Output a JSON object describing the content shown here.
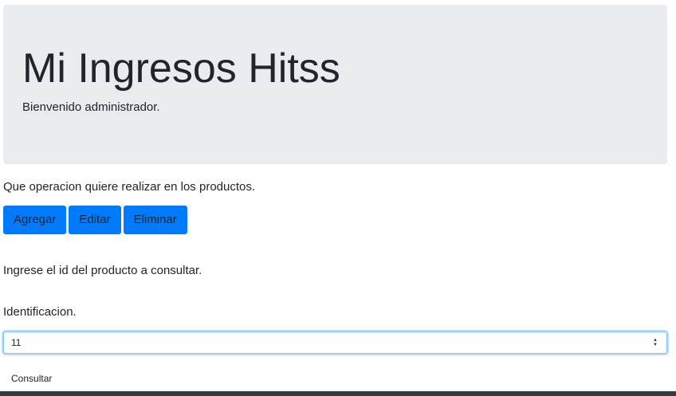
{
  "header": {
    "title": "Mi Ingresos Hitss",
    "welcome": "Bienvenido administrador."
  },
  "main": {
    "operation_prompt": "Que operacion quiere realizar en los productos.",
    "buttons": {
      "add": "Agregar",
      "edit": "Editar",
      "delete": "Eliminar"
    },
    "query_prompt": "Ingrese el id del producto a consultar.",
    "id_label": "Identificacion.",
    "id_input": {
      "value": "11",
      "placeholder": ""
    },
    "query_button": "Consultar"
  },
  "colors": {
    "jumbotron_bg": "#e9ecef",
    "primary": "#007bff",
    "text": "#212529",
    "footer": "#343a40"
  },
  "icons": {
    "spinner": "number-spinner-icon"
  }
}
